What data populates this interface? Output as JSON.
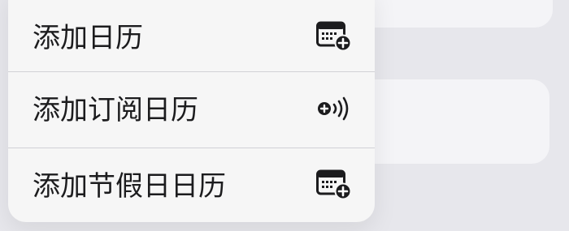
{
  "menu": {
    "items": [
      {
        "label": "添加日历",
        "icon": "calendar-add-icon"
      },
      {
        "label": "添加订阅日历",
        "icon": "subscribe-add-icon"
      },
      {
        "label": "添加节假日日历",
        "icon": "calendar-add-icon"
      }
    ]
  },
  "colors": {
    "background": "#e7e7ec",
    "menu_background": "#f6f6f6",
    "text": "#1c1c1e",
    "separator": "#d1d1d6",
    "icon": "#1c1c1e"
  }
}
